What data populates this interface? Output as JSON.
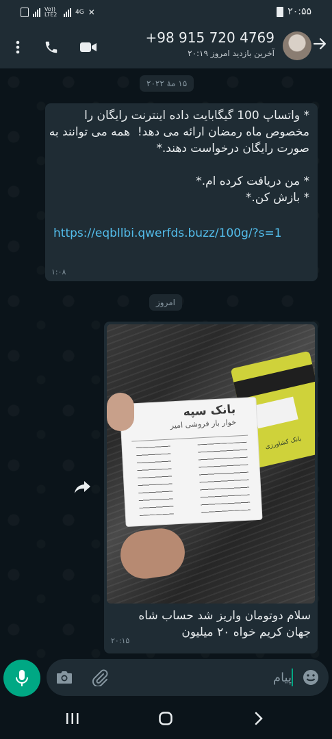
{
  "status_bar": {
    "network_label": "Vo)) LTE2",
    "network_type": "4G",
    "time": "۲۰:۵۵"
  },
  "header": {
    "contact_name": "+98 915 720 4769",
    "last_seen": "آخرین بازدید امروز ۲۰:۱۹",
    "icons": [
      "back-arrow-icon",
      "avatar",
      "video-call-icon",
      "voice-call-icon",
      "more-options-icon"
    ]
  },
  "chat": {
    "date_chip_1": "۱۵ مهٔ ۲۰۲۲",
    "message_1": {
      "text": "* واتساپ 100 گیگابایت داده اینترنت رایگان را مخصوص ماه رمضان ارائه می دهد!  همه می توانند به صورت رایگان درخواست دهند.*\n\n* من دریافت کرده ام.*\n* بازش کن.*",
      "link": "https://eqbllbi.qwerfds.buzz/100g/?s=1",
      "time": "۱:۰۸"
    },
    "date_chip_2": "امروز",
    "message_2": {
      "photo_receipt": {
        "bank_name": "بانک سپه",
        "store": "خوار بار فروشی امیر"
      },
      "caption": "سلام دوتومان واریز شد حساب شاه جهان کریم خواه ۲۰ میلیون",
      "time": "۲۰:۱۵"
    }
  },
  "composer": {
    "placeholder": "پیام",
    "accent_color": "#00a884"
  },
  "colors": {
    "background": "#0b141a",
    "bar": "#1f2c34",
    "bubble": "#1f2c34",
    "link": "#53bdeb"
  }
}
